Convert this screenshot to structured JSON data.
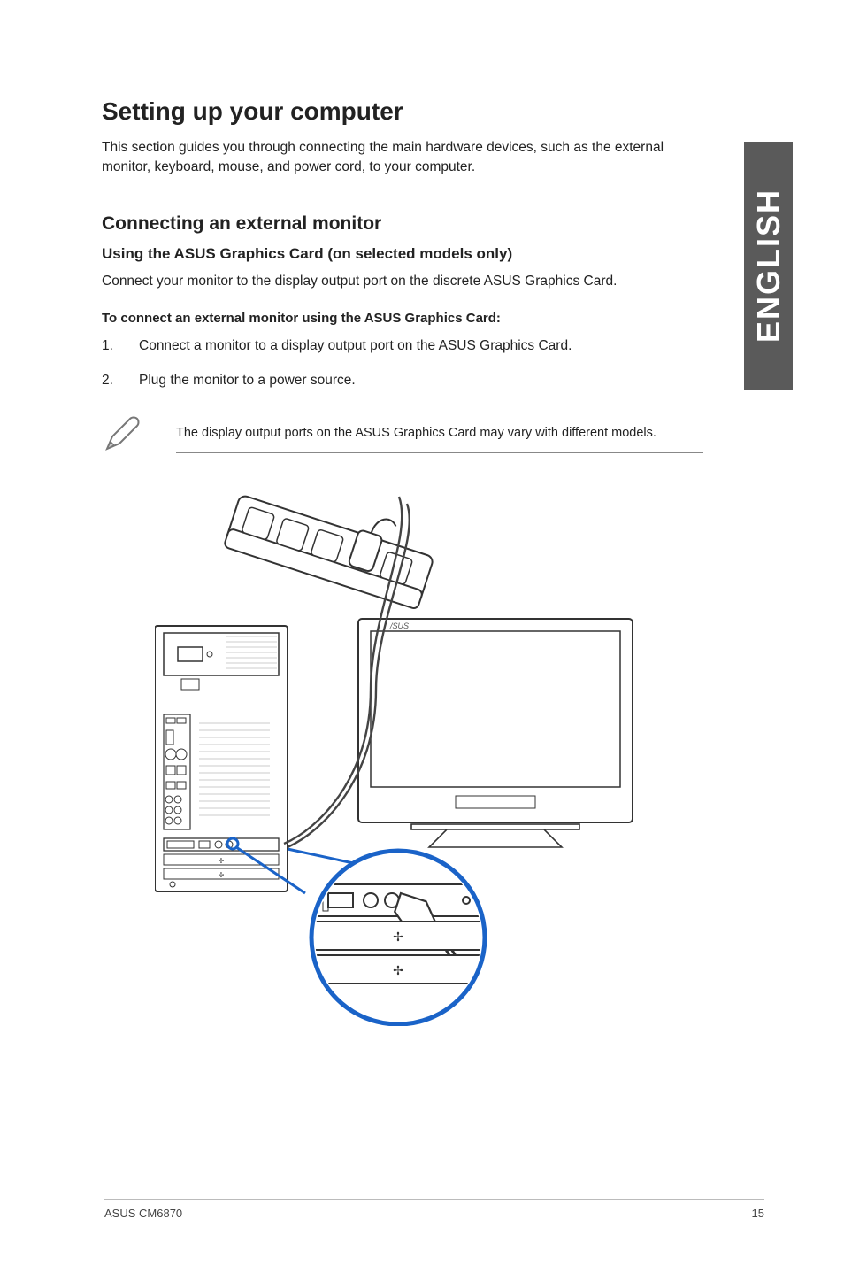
{
  "sideTab": "ENGLISH",
  "title": "Setting up your computer",
  "intro": "This section guides you through connecting the main hardware devices, such as the external monitor, keyboard, mouse, and power cord, to your computer.",
  "h2": "Connecting an external monitor",
  "h3": "Using the ASUS Graphics Card (on selected models only)",
  "bodyAfterH3": "Connect your monitor to the display output port on the discrete ASUS Graphics Card.",
  "stepsHeading": "To connect an external monitor using the ASUS Graphics Card:",
  "steps": [
    {
      "num": "1.",
      "text": "Connect a monitor to a display output port on the ASUS Graphics Card."
    },
    {
      "num": "2.",
      "text": "Plug the monitor to a power source."
    }
  ],
  "noteText": "The display output ports on the ASUS Graphics Card may vary with different models.",
  "footerLeft": "ASUS CM6870",
  "footerRight": "15"
}
